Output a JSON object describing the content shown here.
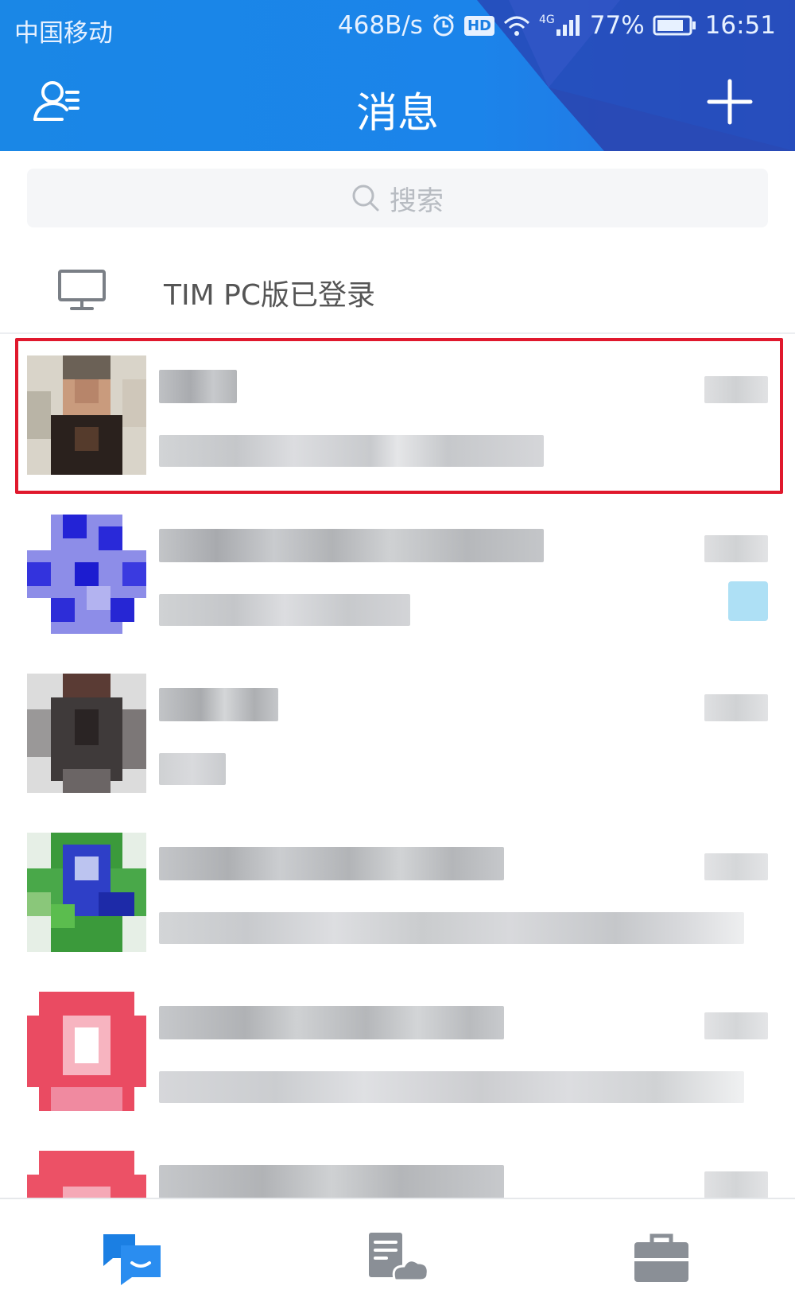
{
  "status_bar": {
    "carrier": "中国移动",
    "network_speed": "468B/s",
    "hd_badge": "HD",
    "network_type": "4G",
    "battery": "77%",
    "time": "16:51"
  },
  "header": {
    "title": "消息",
    "contacts_icon": "contacts-icon",
    "add_icon": "plus-icon"
  },
  "search": {
    "placeholder": "搜索"
  },
  "pc_banner": {
    "label": "TIM PC版已登录",
    "icon": "monitor-icon"
  },
  "colors": {
    "header_blue": "#1b84ea",
    "header_dark": "#2d4fc4",
    "highlight_red": "#e0182d",
    "tab_active": "#1b7fe3",
    "tab_inactive": "#8a8f96"
  },
  "conversations_note": "names, previews and times are pixelated (unreadable)",
  "tabs": [
    {
      "name": "messages",
      "icon": "chat-bubbles-icon",
      "active": true
    },
    {
      "name": "docs",
      "icon": "cloud-document-icon",
      "active": false
    },
    {
      "name": "work",
      "icon": "briefcase-icon",
      "active": false
    }
  ]
}
